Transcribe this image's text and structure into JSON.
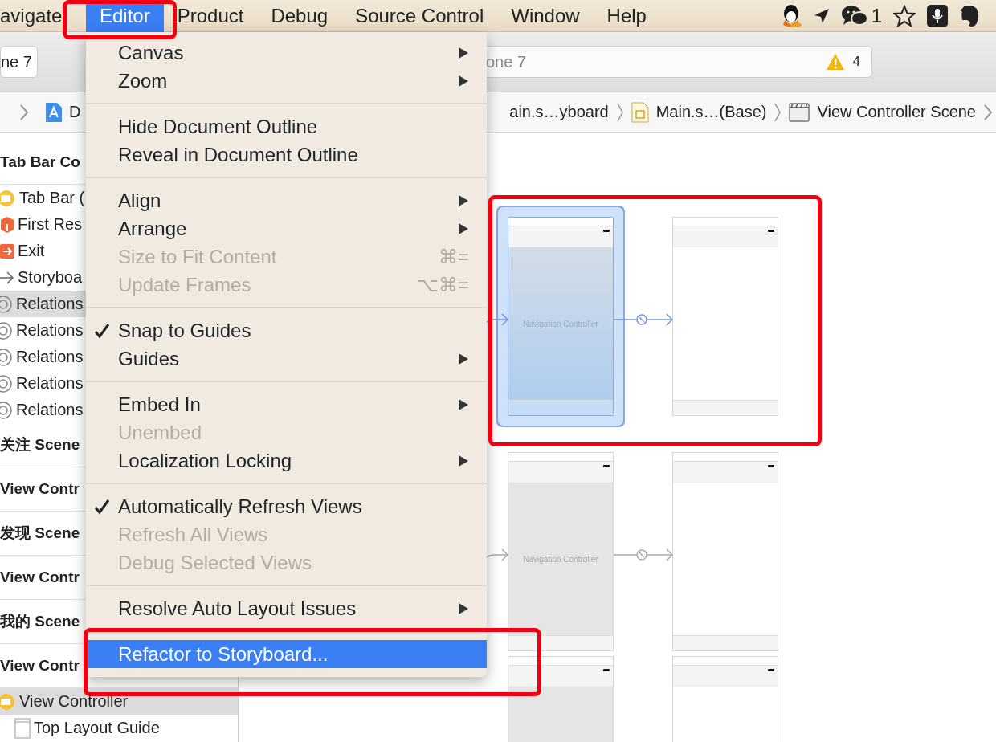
{
  "menu_bar": {
    "items": [
      {
        "label": "avigate",
        "selected": false
      },
      {
        "label": "Editor",
        "selected": true
      },
      {
        "label": "Product",
        "selected": false
      },
      {
        "label": "Debug",
        "selected": false
      },
      {
        "label": "Source Control",
        "selected": false
      },
      {
        "label": "Window",
        "selected": false
      },
      {
        "label": "Help",
        "selected": false
      }
    ],
    "wechat_count": "1"
  },
  "toolbar": {
    "scheme": "ne 7",
    "activity": "one 7",
    "warning_count": "4"
  },
  "jump_bar": {
    "leading": [
      {
        "label": "D",
        "kind": "project"
      }
    ],
    "trailing": [
      {
        "label": "ain.s…yboard",
        "kind": "plain"
      },
      {
        "label": "Main.s…(Base)",
        "kind": "storyboard"
      },
      {
        "label": "View Controller Scene",
        "kind": "scene"
      }
    ]
  },
  "outline": [
    {
      "label": "Tab Bar Co",
      "kind": "scene",
      "selected": false,
      "children": [
        {
          "label": "Tab Bar (",
          "kind": "tabbar",
          "selected": false
        },
        {
          "label": "First Res",
          "kind": "responder",
          "selected": false
        },
        {
          "label": "Exit",
          "kind": "exit",
          "selected": false
        },
        {
          "label": "Storyboa",
          "kind": "segue",
          "selected": false
        },
        {
          "label": "Relations",
          "kind": "relationship",
          "selected": true
        },
        {
          "label": "Relations",
          "kind": "relationship",
          "selected": false
        },
        {
          "label": "Relations",
          "kind": "relationship",
          "selected": false
        },
        {
          "label": "Relations",
          "kind": "relationship",
          "selected": false
        },
        {
          "label": "Relations",
          "kind": "relationship",
          "selected": false
        }
      ]
    },
    {
      "label": "关注 Scene",
      "kind": "scene",
      "selected": false
    },
    {
      "label": "View Contr",
      "kind": "scene",
      "selected": false
    },
    {
      "label": "发现 Scene",
      "kind": "scene",
      "selected": false
    },
    {
      "label": "View Contr",
      "kind": "scene",
      "selected": false
    },
    {
      "label": "我的 Scene",
      "kind": "scene",
      "selected": false
    },
    {
      "label": "View Contr",
      "kind": "scene",
      "selected": false,
      "children": [
        {
          "label": "View Controller",
          "kind": "controller",
          "selected": true,
          "children": [
            {
              "label": "Top Layout Guide",
              "kind": "guide",
              "selected": false
            }
          ]
        }
      ]
    }
  ],
  "canvas": {
    "scenes": [
      {
        "kind": "navigation",
        "label": "Navigation Controller",
        "selected": true
      },
      {
        "kind": "view",
        "selected": false
      },
      {
        "kind": "navigation",
        "label": "Navigation Controller",
        "selected": false
      },
      {
        "kind": "view",
        "selected": false
      },
      {
        "kind": "navigation",
        "selected": false
      },
      {
        "kind": "view",
        "selected": false
      }
    ]
  },
  "editor_menu": [
    {
      "kind": "item",
      "label": "Canvas",
      "submenu": true,
      "checked": false,
      "disabled": false,
      "selected": false
    },
    {
      "kind": "item",
      "label": "Zoom",
      "submenu": true,
      "checked": false,
      "disabled": false,
      "selected": false
    },
    {
      "kind": "separator"
    },
    {
      "kind": "item",
      "label": "Hide Document Outline",
      "submenu": false,
      "checked": false,
      "disabled": false,
      "selected": false
    },
    {
      "kind": "item",
      "label": "Reveal in Document Outline",
      "submenu": false,
      "checked": false,
      "disabled": false,
      "selected": false
    },
    {
      "kind": "separator"
    },
    {
      "kind": "item",
      "label": "Align",
      "submenu": true,
      "checked": false,
      "disabled": false,
      "selected": false
    },
    {
      "kind": "item",
      "label": "Arrange",
      "submenu": true,
      "checked": false,
      "disabled": false,
      "selected": false
    },
    {
      "kind": "item",
      "label": "Size to Fit Content",
      "shortcut": "⌘=",
      "submenu": false,
      "checked": false,
      "disabled": true,
      "selected": false
    },
    {
      "kind": "item",
      "label": "Update Frames",
      "shortcut": "⌥⌘=",
      "submenu": false,
      "checked": false,
      "disabled": true,
      "selected": false
    },
    {
      "kind": "separator"
    },
    {
      "kind": "item",
      "label": "Snap to Guides",
      "submenu": false,
      "checked": true,
      "disabled": false,
      "selected": false
    },
    {
      "kind": "item",
      "label": "Guides",
      "submenu": true,
      "checked": false,
      "disabled": false,
      "selected": false
    },
    {
      "kind": "separator"
    },
    {
      "kind": "item",
      "label": "Embed In",
      "submenu": true,
      "checked": false,
      "disabled": false,
      "selected": false
    },
    {
      "kind": "item",
      "label": "Unembed",
      "submenu": false,
      "checked": false,
      "disabled": true,
      "selected": false
    },
    {
      "kind": "item",
      "label": "Localization Locking",
      "submenu": true,
      "checked": false,
      "disabled": false,
      "selected": false
    },
    {
      "kind": "separator"
    },
    {
      "kind": "item",
      "label": "Automatically Refresh Views",
      "submenu": false,
      "checked": true,
      "disabled": false,
      "selected": false
    },
    {
      "kind": "item",
      "label": "Refresh All Views",
      "submenu": false,
      "checked": false,
      "disabled": true,
      "selected": false
    },
    {
      "kind": "item",
      "label": "Debug Selected Views",
      "submenu": false,
      "checked": false,
      "disabled": true,
      "selected": false
    },
    {
      "kind": "separator"
    },
    {
      "kind": "item",
      "label": "Resolve Auto Layout Issues",
      "submenu": true,
      "checked": false,
      "disabled": false,
      "selected": false
    },
    {
      "kind": "separator"
    },
    {
      "kind": "item",
      "label": "Refactor to Storyboard...",
      "submenu": false,
      "checked": false,
      "disabled": false,
      "selected": true
    }
  ]
}
